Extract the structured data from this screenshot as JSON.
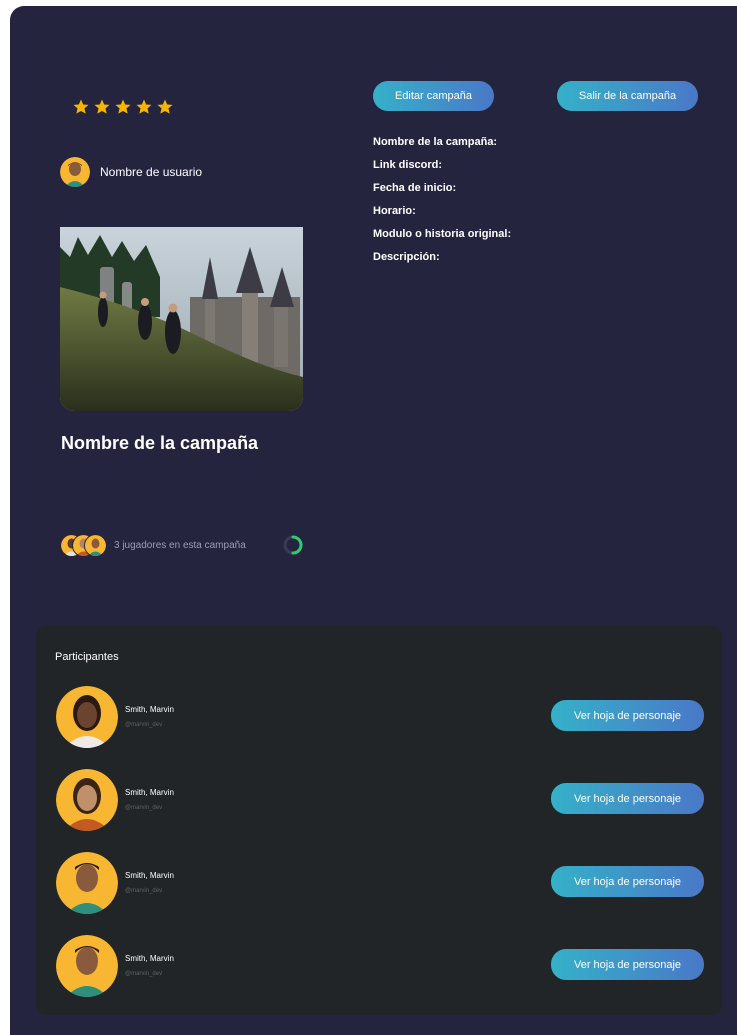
{
  "campaign": {
    "rating_stars": 5,
    "username": "Nombre de usuario",
    "title": "Nombre de la campaña",
    "players_text": "3 jugadores en esta campaña"
  },
  "actions": {
    "edit_label": "Editar campaña",
    "leave_label": "Salir de la campaña"
  },
  "info_fields": [
    "Nombre de la campaña:",
    "Link discord:",
    "Fecha de inicio:",
    "Horario:",
    "Modulo o historia original:",
    "Descripción:"
  ],
  "participants": {
    "title": "Participantes",
    "items": [
      {
        "name": "Smith, Marvin",
        "handle": "@marvin_dev",
        "button": "Ver hoja de personaje"
      },
      {
        "name": "Smith, Marvin",
        "handle": "@marvin_dev",
        "button": "Ver hoja de personaje"
      },
      {
        "name": "Smith, Marvin",
        "handle": "@marvin_dev",
        "button": "Ver hoja de personaje"
      },
      {
        "name": "Smith, Marvin",
        "handle": "@marvin_dev",
        "button": "Ver hoja de personaje"
      }
    ]
  },
  "colors": {
    "card_bg": "#25243f",
    "panel_bg": "#212527",
    "star": "#f7b500",
    "button_start": "#35b1c9",
    "button_end": "#4a78c8",
    "avatar_bg": "#f7b733",
    "spinner": "#2ecc71"
  }
}
